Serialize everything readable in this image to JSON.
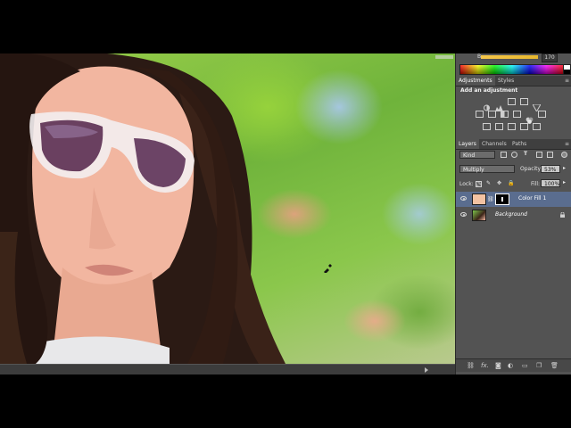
{
  "color_panel": {
    "channel_label": "B",
    "channel_value": "170"
  },
  "adjustments_panel": {
    "tabs": [
      {
        "label": "Adjustments",
        "active": true
      },
      {
        "label": "Styles",
        "active": false
      }
    ],
    "title": "Add an adjustment"
  },
  "layers_panel": {
    "tabs": [
      {
        "label": "Layers",
        "active": true
      },
      {
        "label": "Channels",
        "active": false
      },
      {
        "label": "Paths",
        "active": false
      }
    ],
    "filter_kind": "Kind",
    "blend_mode": "Multiply",
    "opacity_label": "Opacity:",
    "opacity_value": "53%",
    "lock_label": "Lock:",
    "fill_label": "Fill:",
    "fill_value": "100%",
    "layers": [
      {
        "name": "Color Fill 1",
        "selected": true,
        "fill_color": "#f2c2a2"
      },
      {
        "name": "Background",
        "selected": false
      }
    ]
  },
  "colors": {
    "panel_bg": "#535353",
    "selected_layer": "#5a6d8f",
    "fill_swatch": "#f2c2a2"
  }
}
